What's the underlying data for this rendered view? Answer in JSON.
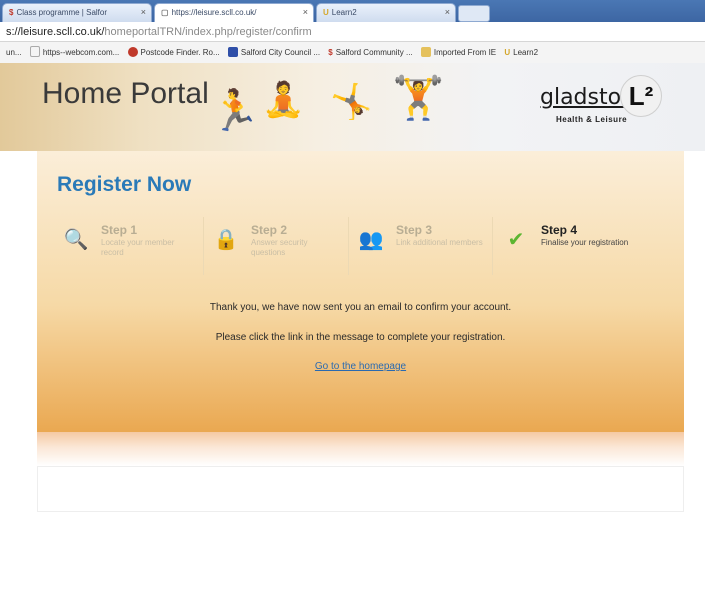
{
  "browser": {
    "tabs": [
      {
        "icon": "$",
        "label": "Class programme | Salfor"
      },
      {
        "icon": "▢",
        "label": "https://leisure.scll.co.uk/"
      },
      {
        "icon": "U",
        "label": "Learn2"
      }
    ],
    "address": {
      "domain": "s://leisure.scll.co.uk/",
      "path": "homeportalTRN/index.php/register/confirm"
    },
    "bookmarks": [
      {
        "label": "un...",
        "color": "#9aa7b8"
      },
      {
        "label": "https--webcom.com...",
        "color": "#d9d9d9"
      },
      {
        "label": "Postcode Finder. Ro...",
        "color": "#c0392b"
      },
      {
        "label": "Salford City Council ...",
        "color": "#2f4fa8"
      },
      {
        "label": "Salford Community ...",
        "color": "#c0392b"
      },
      {
        "label": "Imported From IE",
        "color": "#e5c15c"
      },
      {
        "label": "Learn2",
        "color": "#e5c15c"
      }
    ]
  },
  "banner": {
    "title": "Home Portal",
    "logo_text": "gladstone",
    "logo_badge": "L²",
    "logo_subtitle": "Health & Leisure"
  },
  "register": {
    "title": "Register Now",
    "steps": [
      {
        "title": "Step 1",
        "desc": "Locate your member record",
        "icon": "magnifier-icon"
      },
      {
        "title": "Step 2",
        "desc": "Answer security questions",
        "icon": "padlock-icon"
      },
      {
        "title": "Step 3",
        "desc": "Link additional members",
        "icon": "people-icon"
      },
      {
        "title": "Step 4",
        "desc": "Finalise your registration",
        "icon": "checkmark-icon"
      }
    ],
    "message1": "Thank you, we have now sent you an email to confirm your account.",
    "message2": "Please click the link in the message to complete your registration.",
    "home_link": "Go to the homepage"
  },
  "colors": {
    "accent": "#2a7ab8",
    "panel_bottom": "#eaa851",
    "check": "#5cb531"
  }
}
